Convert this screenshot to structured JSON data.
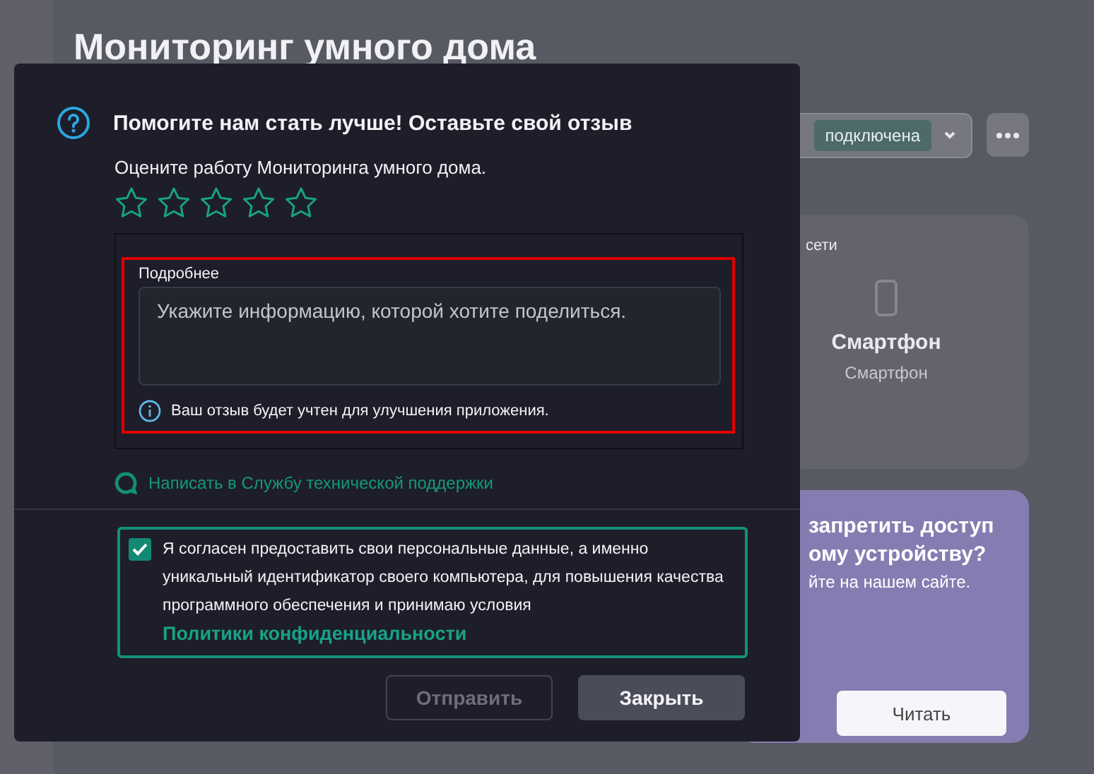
{
  "background": {
    "title": "Мониторинг умного дома",
    "status": "подключена",
    "network_card": {
      "caption": "сети",
      "device_name": "Смартфон",
      "device_type": "Смартфон"
    },
    "promo_card": {
      "title_line_1": "запретить доступ",
      "title_line_2": "ому устройству?",
      "text": "йте на нашем сайте.",
      "button": "Читать"
    }
  },
  "dialog": {
    "title": "Помогите нам стать лучше! Оставьте свой отзыв",
    "prompt": "Оцените работу Мониторинга умного дома.",
    "stars": 0,
    "details": {
      "label": "Подробнее",
      "placeholder": "Укажите информацию, которой хотите поделиться.",
      "hint": "Ваш отзыв будет учтен для улучшения приложения."
    },
    "support_link": "Написать в Службу технической поддержки",
    "consent": {
      "checked": true,
      "text": "Я согласен предоставить свои персональные данные, а именно уникальный идентификатор своего компьютера, для повышения качества программного обеспечения и принимаю условия",
      "link": "Политики конфиденциальности"
    },
    "buttons": [
      {
        "label": "Отправить",
        "kind": "secondary",
        "disabled": true
      },
      {
        "label": "Закрыть",
        "kind": "primary",
        "disabled": false
      }
    ]
  }
}
